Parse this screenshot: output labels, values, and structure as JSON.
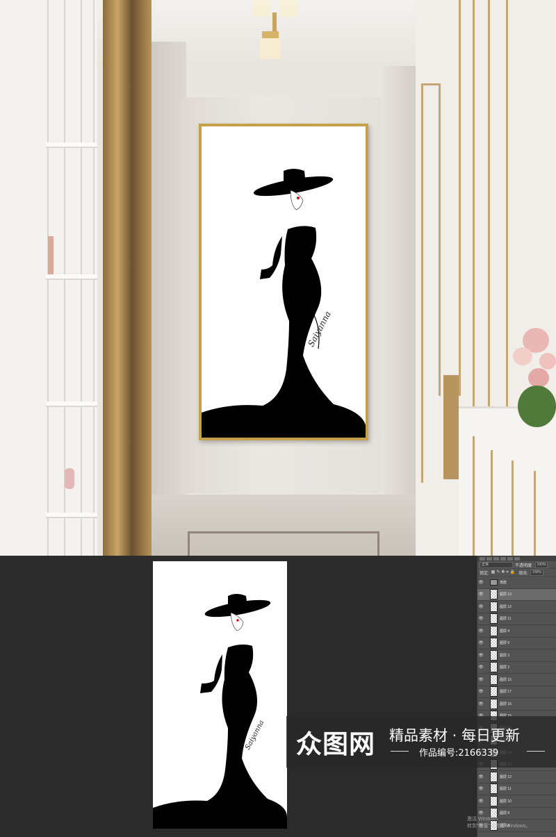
{
  "watermark": {
    "logo": "众图网",
    "slogan": "精品素材 · 每日更新",
    "work_id": "作品编号:2166339"
  },
  "layers_panel": {
    "blend_mode": "正常",
    "opacity_label": "不透明度:",
    "opacity_value": "100%",
    "lock_label": "锁定:",
    "fill_label": "填充:",
    "fill_value": "100%",
    "layers": [
      {
        "name": "落款",
        "type": "group"
      },
      {
        "name": "图层 13",
        "type": "layer",
        "selected": true
      },
      {
        "name": "图层 12",
        "type": "layer"
      },
      {
        "name": "图层 11",
        "type": "layer"
      },
      {
        "name": "图层 4",
        "type": "layer"
      },
      {
        "name": "图层 6",
        "type": "layer"
      },
      {
        "name": "图层 3",
        "type": "layer"
      },
      {
        "name": "图层 2",
        "type": "layer"
      },
      {
        "name": "图层 15",
        "type": "layer"
      },
      {
        "name": "图层 17",
        "type": "layer"
      },
      {
        "name": "图层 16",
        "type": "layer"
      },
      {
        "name": "图层 15",
        "type": "layer"
      },
      {
        "name": "图层 15",
        "type": "layer"
      },
      {
        "name": "图层 17",
        "type": "layer"
      },
      {
        "name": "图层 14",
        "type": "layer"
      },
      {
        "name": "图层 13",
        "type": "layer"
      },
      {
        "name": "图层 12",
        "type": "layer"
      },
      {
        "name": "图层 11",
        "type": "layer"
      },
      {
        "name": "图层 10",
        "type": "layer"
      },
      {
        "name": "图层 9",
        "type": "layer"
      },
      {
        "name": "图层 8",
        "type": "layer"
      }
    ]
  },
  "system_notice": {
    "line1": "激活 Windows",
    "line2": "转到\"设置\"以激活 Windows。"
  },
  "colors": {
    "frame_gold": "#c7a04a",
    "workspace": "#2b2b2b",
    "panel": "#535353",
    "lip_red": "#c0181e"
  }
}
